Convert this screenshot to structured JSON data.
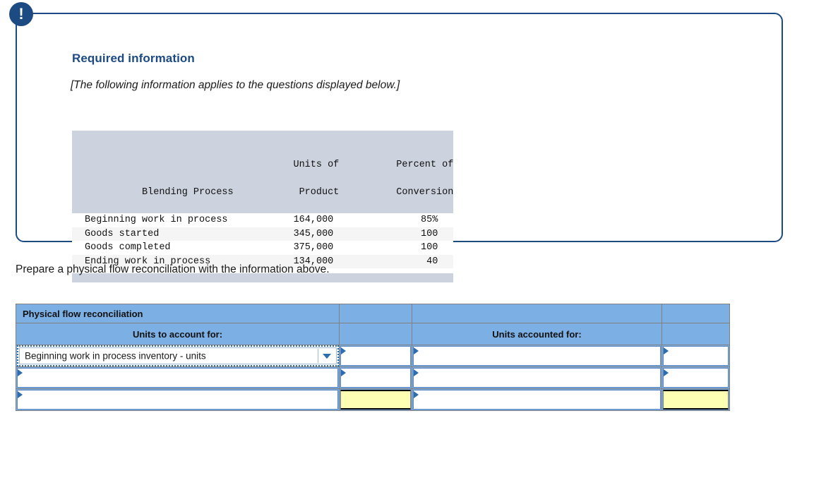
{
  "card": {
    "badge_glyph": "!",
    "heading": "Required information",
    "note": "[The following information applies to the questions displayed below.]"
  },
  "info_table": {
    "col_headers": [
      {
        "top": "",
        "bottom": "Blending Process"
      },
      {
        "top": "Units of",
        "bottom": "Product"
      },
      {
        "top": "Percent of",
        "bottom": "Conversion"
      }
    ],
    "rows": [
      {
        "label": "Beginning work in process",
        "units": "164,000",
        "percent": "85%"
      },
      {
        "label": "Goods started",
        "units": "345,000",
        "percent": "100"
      },
      {
        "label": "Goods completed",
        "units": "375,000",
        "percent": "100"
      },
      {
        "label": "Ending work in process",
        "units": "134,000",
        "percent": "40"
      }
    ]
  },
  "prompt": "Prepare a physical flow reconciliation with the information above.",
  "worksheet": {
    "title": "Physical flow reconciliation",
    "left_section_header": "Units to account for:",
    "right_section_header": "Units accounted for:",
    "dropdown": {
      "selected": "Beginning work in process inventory - units",
      "caret": "dropdown-caret"
    },
    "rows": [
      {
        "left_value": "",
        "left_amount": "",
        "right_value": "",
        "right_amount": ""
      },
      {
        "left_value": "",
        "left_amount": "",
        "right_value": "",
        "right_amount": ""
      },
      {
        "left_value": "",
        "left_amount": "",
        "right_value": "",
        "right_amount": ""
      }
    ]
  },
  "colors": {
    "card_border": "#1C4B84",
    "heading": "#1C4B84",
    "table_header_bg": "#CCD2DE",
    "table_alt_row": "#F5F5F5",
    "worksheet_header_bg": "#7CAFE4",
    "total_cell_bg": "#FFFFB3",
    "marker": "#2E6CB0"
  }
}
